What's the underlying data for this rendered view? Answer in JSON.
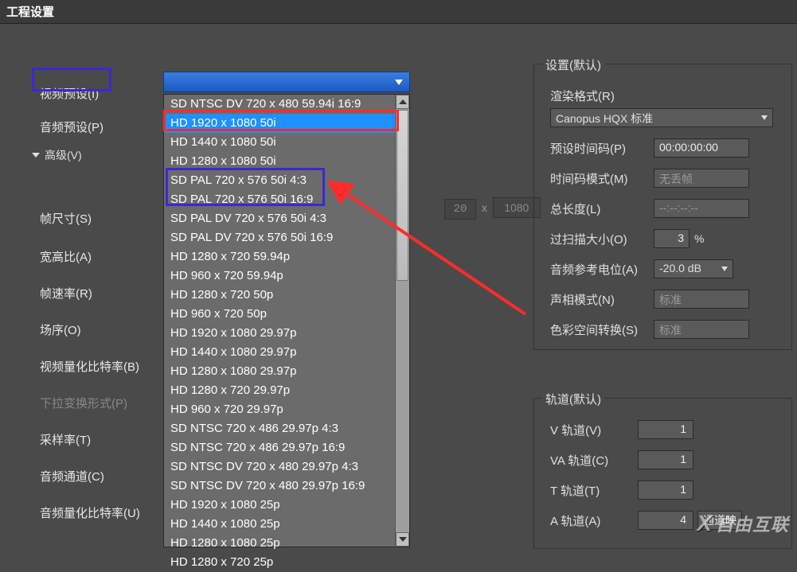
{
  "title": "工程设置",
  "left": {
    "video_preset": "视频预设(I)",
    "audio_preset": "音频预设(P)",
    "advanced": "高级(V)",
    "frame_size": "帧尺寸(S)",
    "aspect_ratio": "宽高比(A)",
    "frame_rate": "帧速率(R)",
    "field_order": "场序(O)",
    "video_bitrate": "视频量化比特率(B)",
    "pulldown": "下拉变换形式(P)",
    "sample_rate": "采样率(T)",
    "audio_channel": "音频通道(C)",
    "audio_bitrate": "音频量化比特率(U)"
  },
  "dropdown": {
    "items": [
      "SD NTSC DV 720 x 480 59.94i 16:9",
      "HD 1920 x 1080 50i",
      "HD 1440 x 1080 50i",
      "HD 1280 x 1080 50i",
      "SD PAL 720 x 576 50i 4:3",
      "SD PAL 720 x 576 50i 16:9",
      "SD PAL DV 720 x 576 50i 4:3",
      "SD PAL DV 720 x 576 50i 16:9",
      "HD 1280 x 720 59.94p",
      "HD 960 x 720 59.94p",
      "HD 1280 x 720 50p",
      "HD 960 x 720 50p",
      "HD 1920 x 1080 29.97p",
      "HD 1440 x 1080 29.97p",
      "HD 1280 x 1080 29.97p",
      "HD 1280 x 720 29.97p",
      "HD 960 x 720 29.97p",
      "SD NTSC 720 x 486 29.97p 4:3",
      "SD NTSC 720 x 486 29.97p 16:9",
      "SD NTSC DV 720 x 480 29.97p 4:3",
      "SD NTSC DV 720 x 480 29.97p 16:9",
      "HD 1920 x 1080 25p",
      "HD 1440 x 1080 25p",
      "HD 1280 x 1080 25p",
      "HD 1280 x 720 25p"
    ]
  },
  "mid": {
    "w": "20",
    "x": "x",
    "h": "1080"
  },
  "settings": {
    "legend": "设置(默认)",
    "render_label": "渲染格式(R)",
    "render_value": "Canopus HQX 标准",
    "timecode_label": "预设时间码(P)",
    "timecode_value": "00:00:00:00",
    "tc_mode_label": "时间码模式(M)",
    "tc_mode_value": "无丢帧",
    "total_label": "总长度(L)",
    "total_value": "--:--:--:--",
    "overscan_label": "过扫描大小(O)",
    "overscan_value": "3",
    "overscan_unit": "%",
    "audio_ref_label": "音频参考电位(A)",
    "audio_ref_value": "-20.0 dB",
    "pan_label": "声相模式(N)",
    "pan_value": "标准",
    "cspace_label": "色彩空间转换(S)",
    "cspace_value": "标准"
  },
  "tracks": {
    "legend": "轨道(默认)",
    "v_label": "V 轨道(V)",
    "v_val": "1",
    "va_label": "VA 轨道(C)",
    "va_val": "1",
    "t_label": "T 轨道(T)",
    "t_val": "1",
    "a_label": "A 轨道(A)",
    "a_val": "4",
    "a_btn": "通道映"
  },
  "watermark": "自由互联"
}
